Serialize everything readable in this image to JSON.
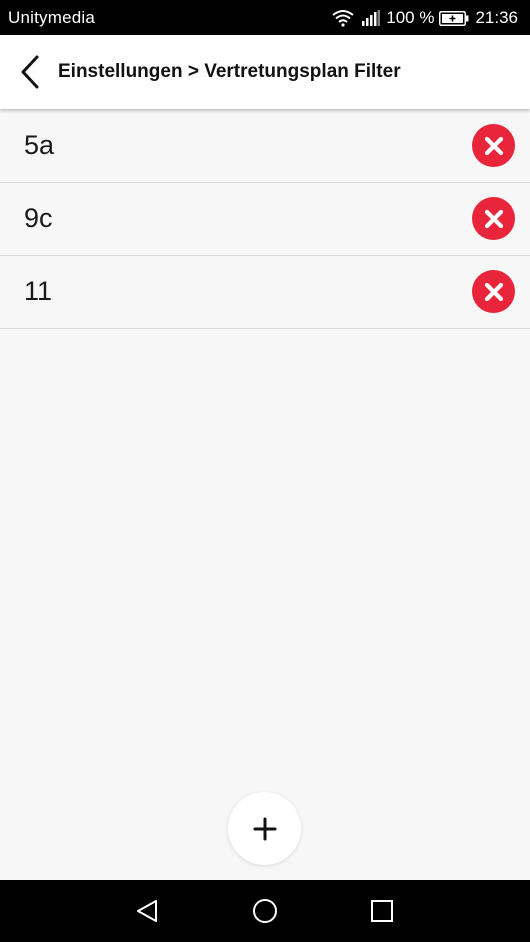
{
  "status_bar": {
    "carrier": "Unitymedia",
    "battery_text": "100 %",
    "time": "21:36",
    "icons": [
      "wifi-icon",
      "signal-icon",
      "battery-charging-icon"
    ]
  },
  "app_bar": {
    "title": "Einstellungen > Vertretungsplan Filter",
    "back_icon": "chevron-left-icon"
  },
  "filters": [
    {
      "label": "5a"
    },
    {
      "label": "9c"
    },
    {
      "label": "11"
    }
  ],
  "remove_icon": "close-circle-icon",
  "fab_icon": "plus-icon",
  "nav_bar": {
    "icons": [
      "nav-back-icon",
      "nav-home-icon",
      "nav-recents-icon"
    ]
  },
  "colors": {
    "remove_red": "#e8253a",
    "background": "#f7f7f7",
    "app_bar": "#ffffff",
    "status_bar": "#000000"
  }
}
